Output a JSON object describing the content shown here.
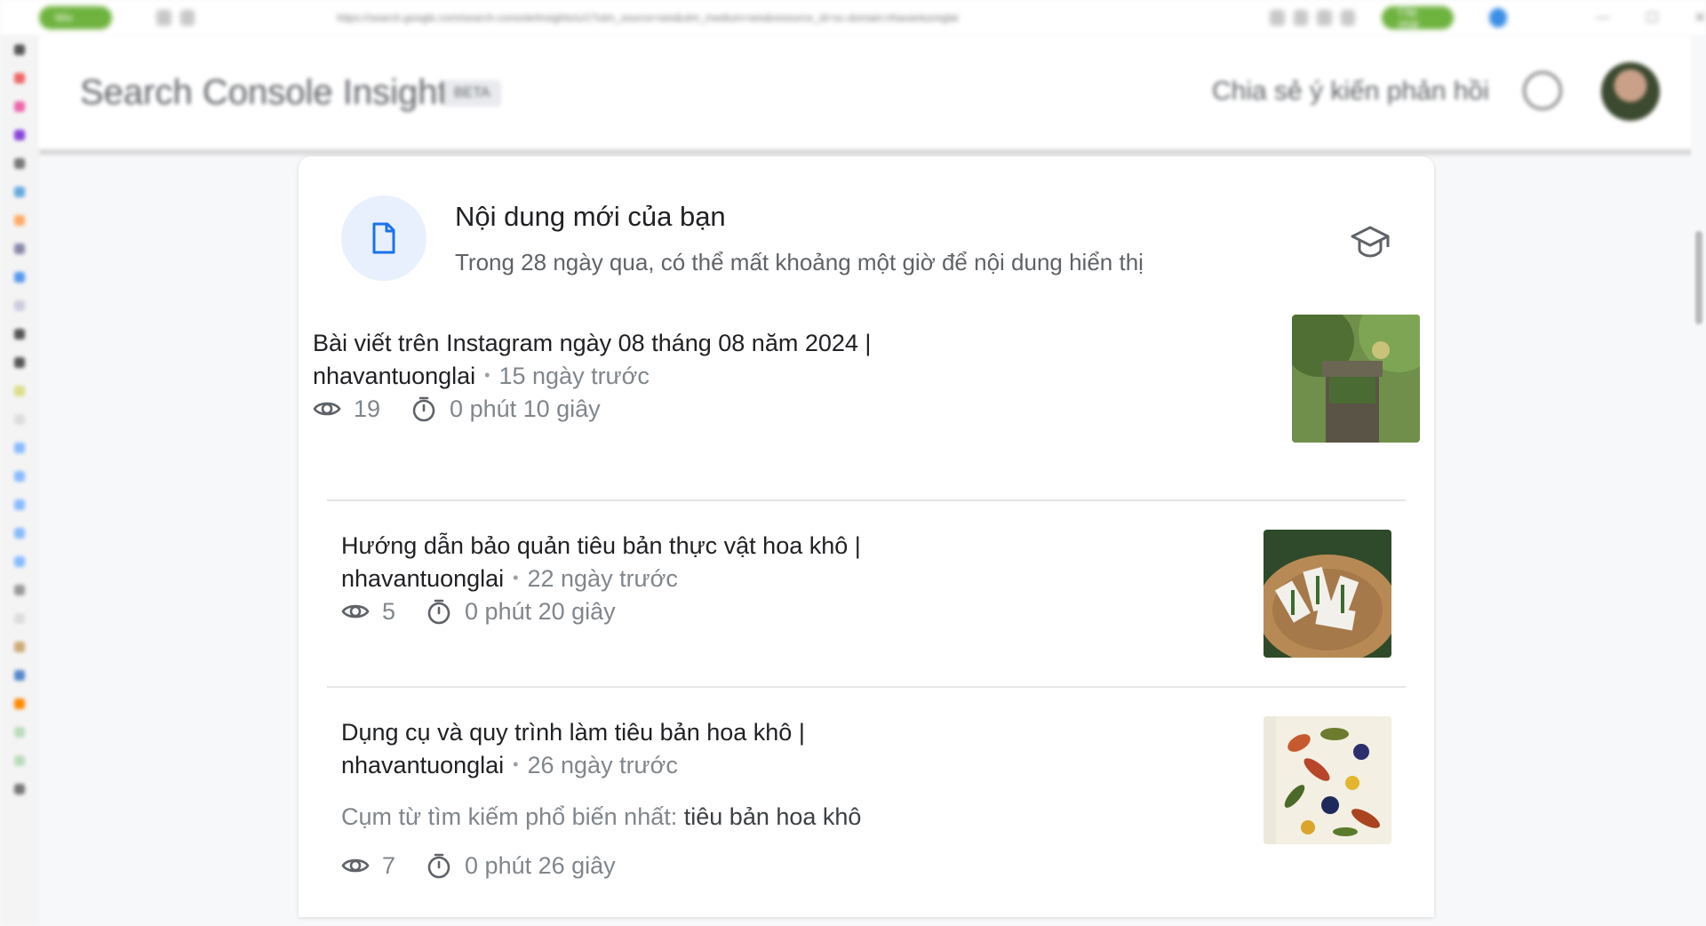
{
  "browser": {
    "profile_pill": "Wix",
    "url": "https://search.google.com/search-console/insights/u/1?utm_source=wix&utm_medium=wix&resource_id=sc-domain:nhavantuonglai",
    "update_pill": "Cập nhật"
  },
  "header": {
    "title": "Search Console Insights",
    "badge": "BETA",
    "feedback": "Chia sẻ ý kiến phản hồi"
  },
  "card": {
    "title": "Nội dung mới của bạn",
    "subtitle": "Trong 28 ngày qua, có thể mất khoảng một giờ để nội dung hiển thị",
    "items": [
      {
        "title_main": "Bài viết trên Instagram ngày 08 tháng 08 năm 2024 |",
        "source": "nhavantuonglai",
        "age": "15 ngày trước",
        "views": "19",
        "duration": "0 phút 10 giây"
      },
      {
        "title_main": "Hướng dẫn bảo quản tiêu bản thực vật hoa khô |",
        "source": "nhavantuonglai",
        "age": "22 ngày trước",
        "views": "5",
        "duration": "0 phút 20 giây"
      },
      {
        "title_main": "Dụng cụ và quy trình làm tiêu bản hoa khô |",
        "source": "nhavantuonglai",
        "age": "26 ngày trước",
        "query_label": "Cụm từ tìm kiếm phổ biến nhất:",
        "query_term": "tiêu bản hoa khô",
        "views": "7",
        "duration": "0 phút 26 giây"
      }
    ]
  },
  "icons": {
    "doc": "document-icon",
    "learn": "graduation-cap-icon",
    "views": "eye-icon",
    "duration": "timer-icon"
  },
  "colors": {
    "accent": "#1a73e8",
    "badge_bg": "#e8f0fe",
    "muted_text": "#80868b"
  }
}
